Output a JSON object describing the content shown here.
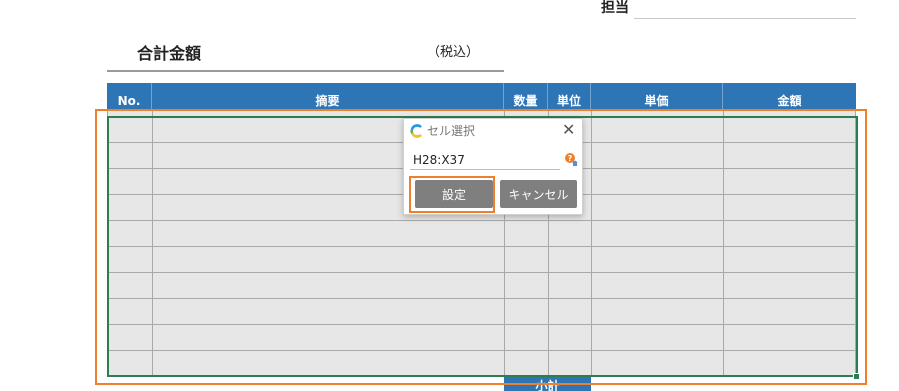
{
  "header": {
    "tanto_label": "担当",
    "total_label": "合計金額",
    "tax_label": "（税込）"
  },
  "table": {
    "columns": [
      "No.",
      "摘要",
      "数量",
      "単位",
      "単価",
      "金額"
    ],
    "row_count": 10,
    "subtotal_label": "小計"
  },
  "dialog": {
    "title": "セル選択",
    "range_value": "H28:X37",
    "set_button": "設定",
    "cancel_button": "キャンセル",
    "close_icon": "close-icon",
    "help_icon": "help-icon",
    "app_icon": "app-logo-icon"
  },
  "colors": {
    "header_blue": "#2e75b6",
    "selection_green": "#2e7d4f",
    "highlight_orange": "#ee7f2d",
    "button_gray": "#7f7f7f",
    "cell_gray": "#e7e7e7"
  }
}
